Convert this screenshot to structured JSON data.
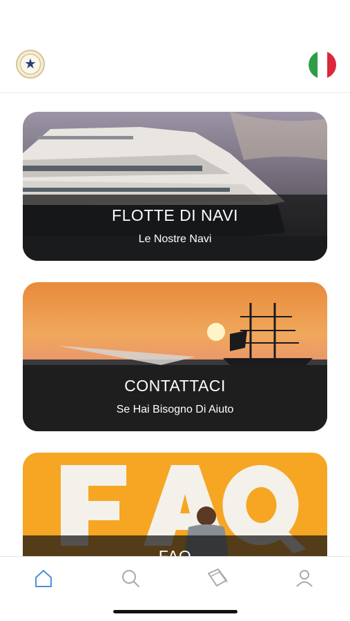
{
  "header": {
    "logo_icon": "ship-club-logo",
    "language": "italian-flag",
    "flag_colors": [
      "#2d9e45",
      "#ffffff",
      "#d8283a"
    ]
  },
  "cards": [
    {
      "title": "FLOTTE DI NAVI",
      "subtitle": "Le Nostre Navi",
      "image": "yacht"
    },
    {
      "title": "CONTATTACI",
      "subtitle": "Se Hai Bisogno Di Aiuto",
      "image": "sunset-sailing-ship"
    },
    {
      "title": "FAQ",
      "subtitle": "",
      "image": "faq-poster"
    }
  ],
  "tabs": [
    {
      "name": "home",
      "icon": "home-icon",
      "active": true
    },
    {
      "name": "search",
      "icon": "search-icon",
      "active": false
    },
    {
      "name": "tickets",
      "icon": "tickets-icon",
      "active": false
    },
    {
      "name": "profile",
      "icon": "profile-icon",
      "active": false
    }
  ],
  "colors": {
    "active_tab": "#4a8fd6",
    "inactive_tab": "#a9a9a9",
    "faq_orange": "#f6a623"
  }
}
